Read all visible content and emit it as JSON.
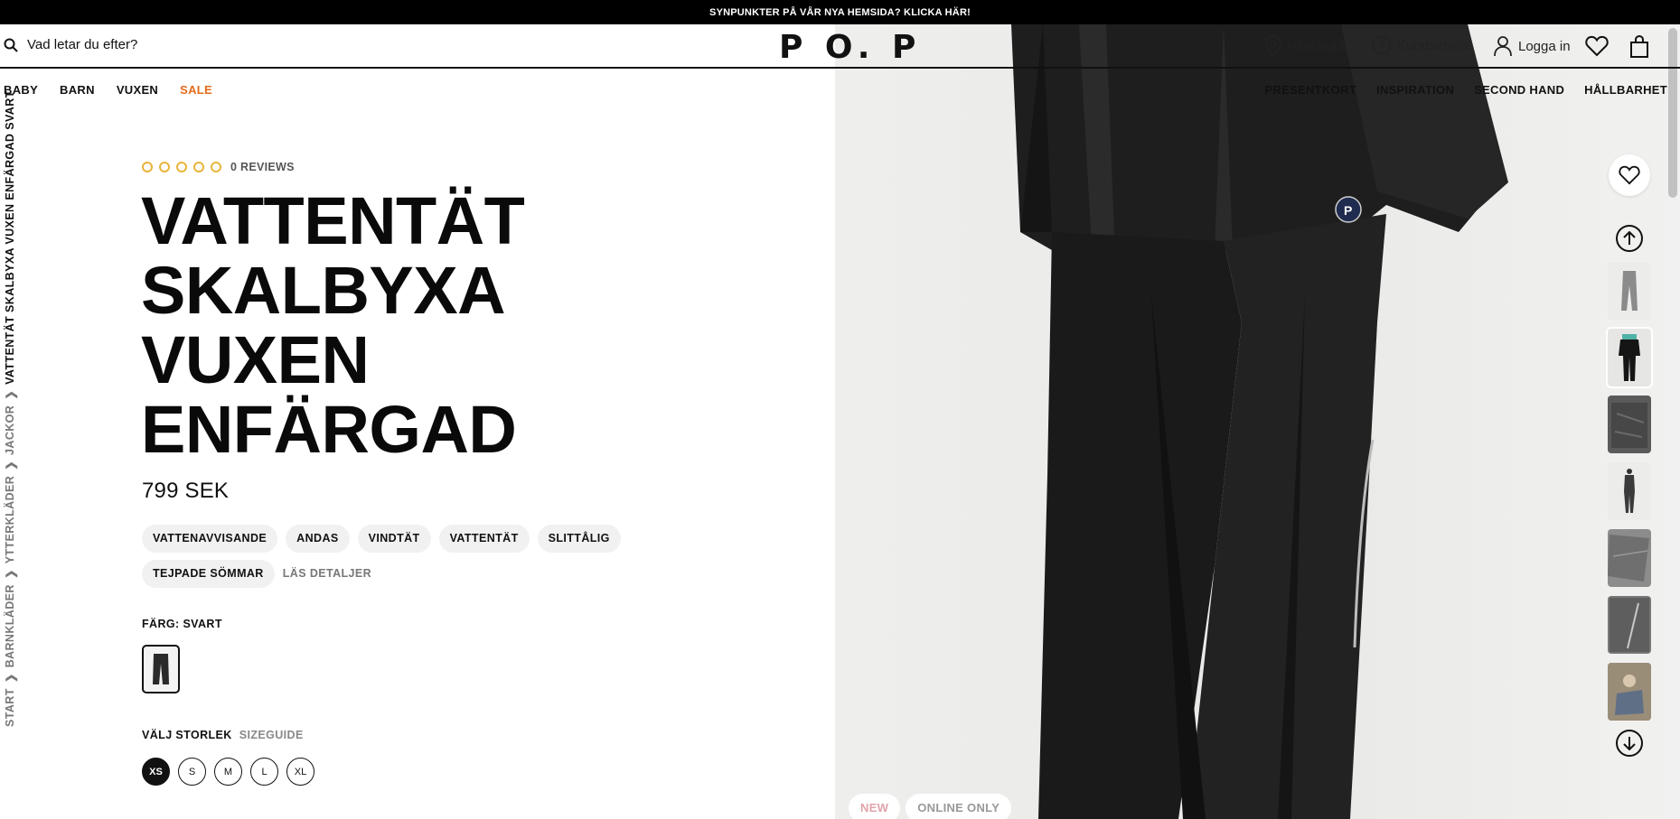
{
  "announcement": "SYNPUNKTER PÅ VÅR NYA HEMSIDA? KLICKA HÄR!",
  "header": {
    "search_placeholder": "Vad letar du efter?",
    "logo": "P O. P",
    "find_store": "Hitta butik",
    "customer_service": "Kundservice",
    "login": "Logga in",
    "icons": [
      "search-icon",
      "location-pin-icon",
      "help-icon",
      "user-icon",
      "heart-icon",
      "bag-icon"
    ]
  },
  "nav_left": [
    "BABY",
    "BARN",
    "VUXEN",
    "SALE"
  ],
  "nav_right": [
    "PRESENTKORT",
    "INSPIRATION",
    "SECOND HAND",
    "HÅLLBARHET"
  ],
  "breadcrumb": {
    "items": [
      "START",
      "BARNKLÄDER",
      "YTTERKLÄDER",
      "JACKOR"
    ],
    "current": "VATTENTÄT SKALBYXA VUXEN ENFÄRGAD SVART",
    "separator": "❯"
  },
  "product": {
    "rating_count": 0,
    "reviews_label": "0 REVIEWS",
    "title_lines": [
      "VATTENTÄT",
      "SKALBYXA",
      "VUXEN",
      "ENFÄRGAD"
    ],
    "price": "799 SEK",
    "features": [
      "VATTENAVVISANDE",
      "ANDAS",
      "VINDTÄT",
      "VATTENTÄT",
      "SLITTÅLIG",
      "TEJPADE SÖMMAR"
    ],
    "details_link": "LÄS DETALJER",
    "color_label": "FÄRG: SVART",
    "size_label": "VÄLJ STORLEK",
    "sizeguide": "SIZEGUIDE",
    "sizes": [
      "XS",
      "S",
      "M",
      "L",
      "XL"
    ],
    "selected_size": "XS"
  },
  "gallery": {
    "badges": [
      "NEW",
      "ONLINE ONLY"
    ],
    "thumbnail_count": 7
  },
  "colors": {
    "sale": "#e46b1b",
    "rating_circle": "#e8b53a",
    "badge_new": "#e2a3ab"
  }
}
